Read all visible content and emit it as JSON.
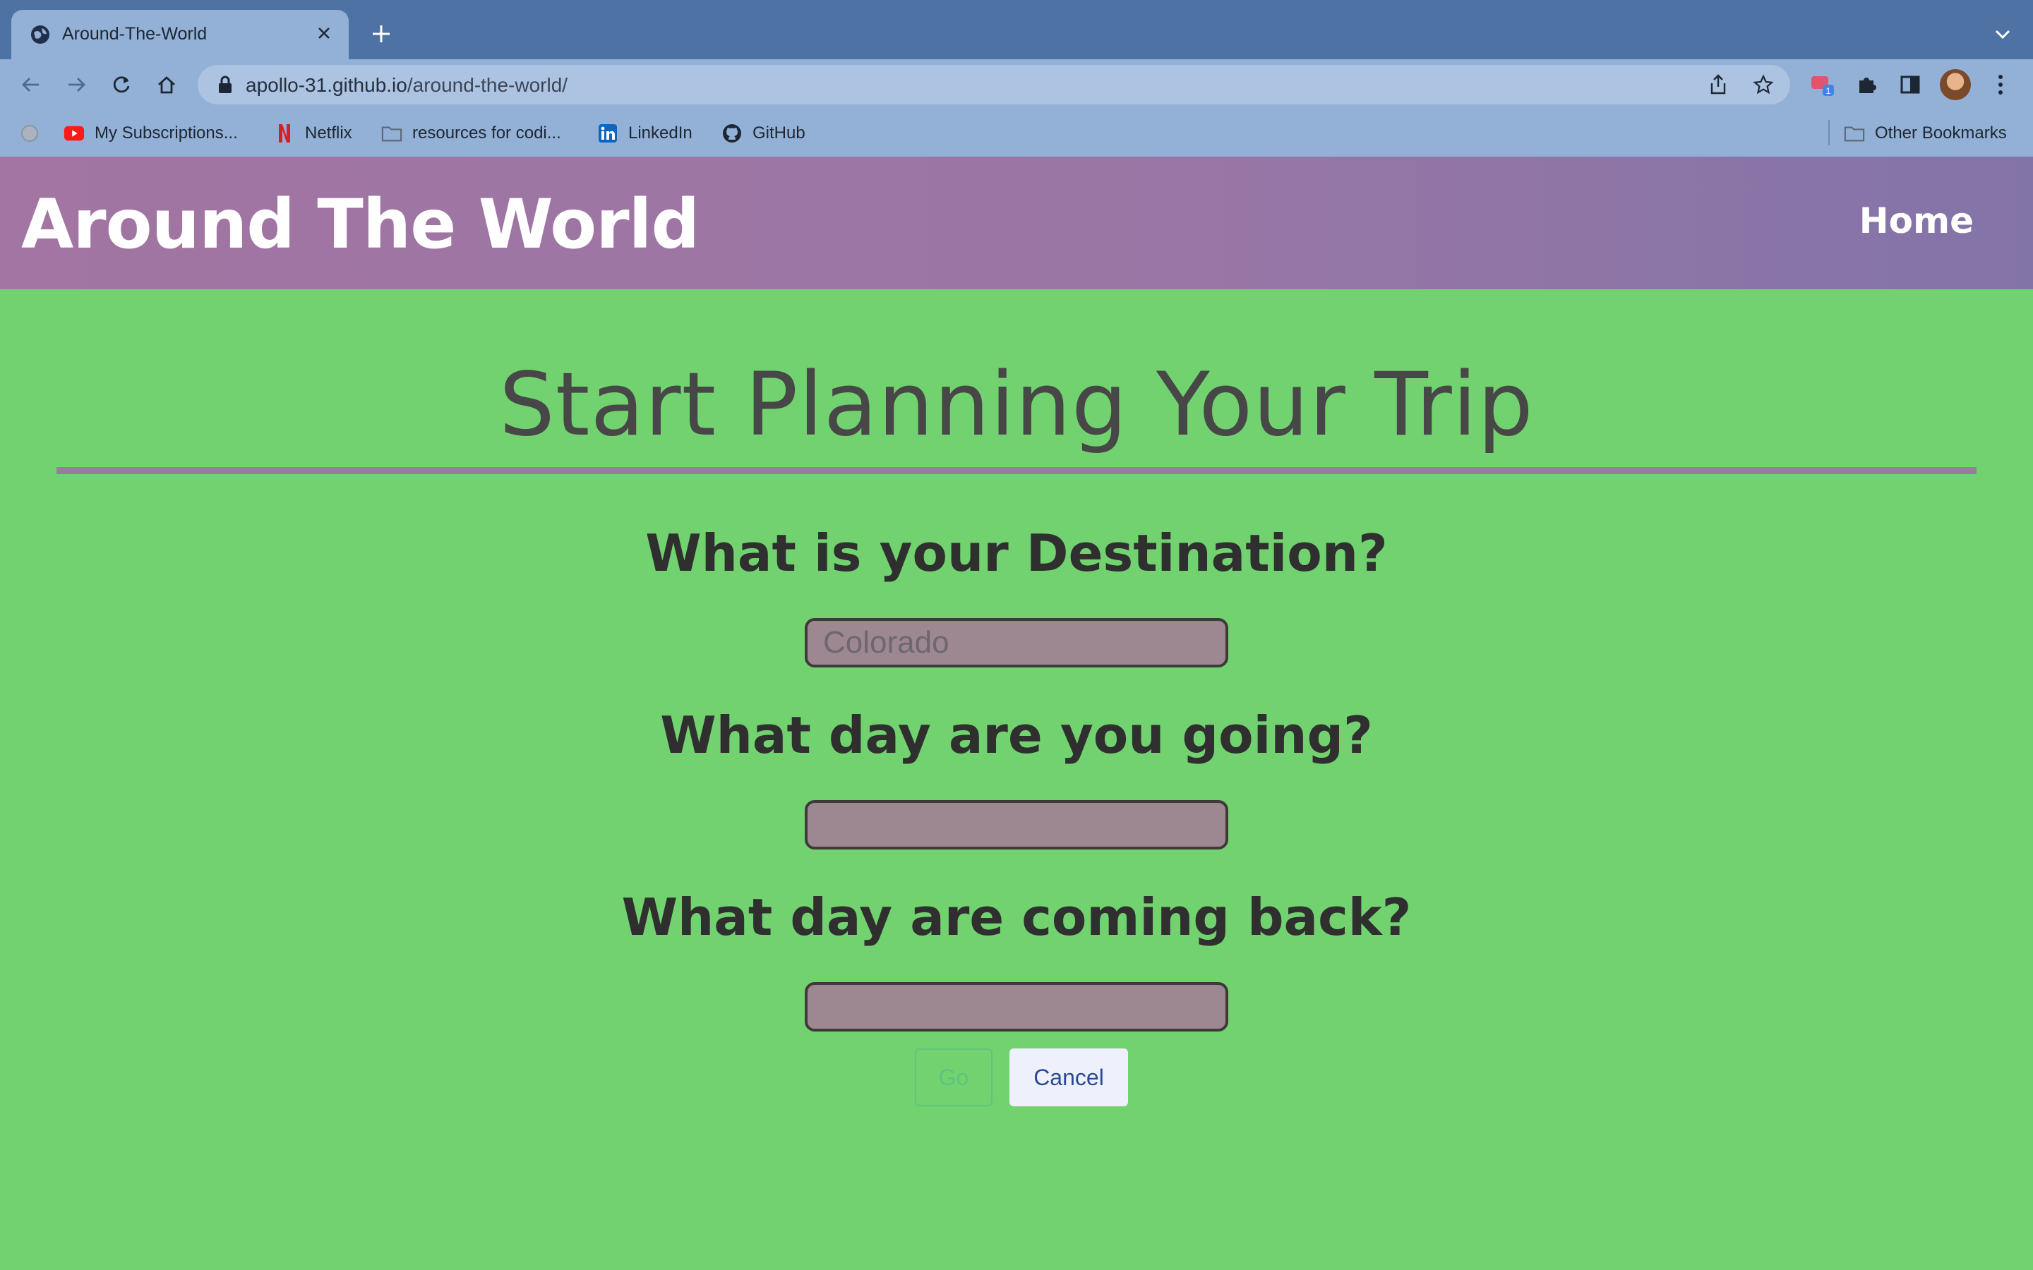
{
  "browser": {
    "tab": {
      "title": "Around-The-World"
    },
    "url": {
      "host": "apollo-31.github.io",
      "path": "/around-the-world/"
    },
    "extension_badge": "1",
    "bookmarks": [
      {
        "label": "My Subscriptions...",
        "icon": "youtube-icon"
      },
      {
        "label": "Netflix",
        "icon": "netflix-icon"
      },
      {
        "label": "resources for codi...",
        "icon": "folder-icon"
      },
      {
        "label": "LinkedIn",
        "icon": "linkedin-icon"
      },
      {
        "label": "GitHub",
        "icon": "github-icon"
      }
    ],
    "other_bookmarks": "Other Bookmarks"
  },
  "site": {
    "title": "Around The World",
    "nav": {
      "home": "Home"
    }
  },
  "form": {
    "heading": "Start Planning Your Trip",
    "destination": {
      "question": "What is your Destination?",
      "placeholder": "Colorado",
      "value": ""
    },
    "depart": {
      "question": "What day are you going?",
      "value": ""
    },
    "return": {
      "question": "What day are coming back?",
      "value": ""
    },
    "go_label": "Go",
    "cancel_label": "Cancel"
  },
  "colors": {
    "page_background": "#72d270",
    "header_gradient_start": "#a275a2",
    "header_gradient_end": "#8374a8",
    "input_background": "#9d8791",
    "rule": "#9a7aa0"
  }
}
